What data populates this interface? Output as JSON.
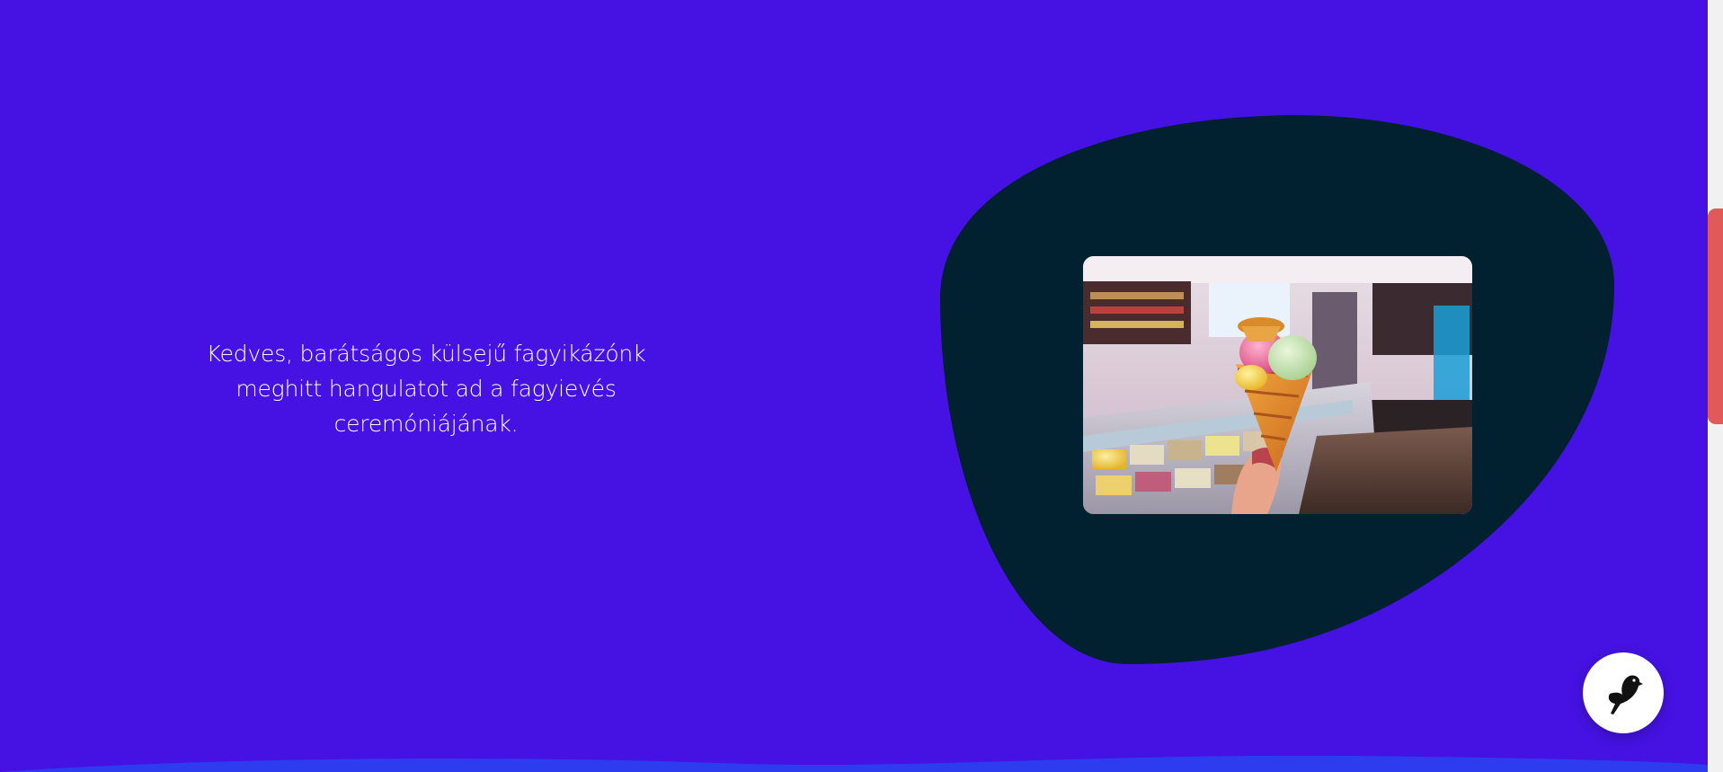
{
  "section": {
    "text": "Kedves, barátságos külsejű fagyikázónk meghitt hangulatot ad a fagyievés ceremóniájának.",
    "background_color": "#4512e3",
    "blob_color": "#012030"
  },
  "photo": {
    "subject": "hand holding an ice cream cone in an ice cream parlor"
  },
  "chat_widget": {
    "icon": "bird-icon"
  },
  "scrollbar": {
    "thumb_color": "#e05a5a"
  }
}
